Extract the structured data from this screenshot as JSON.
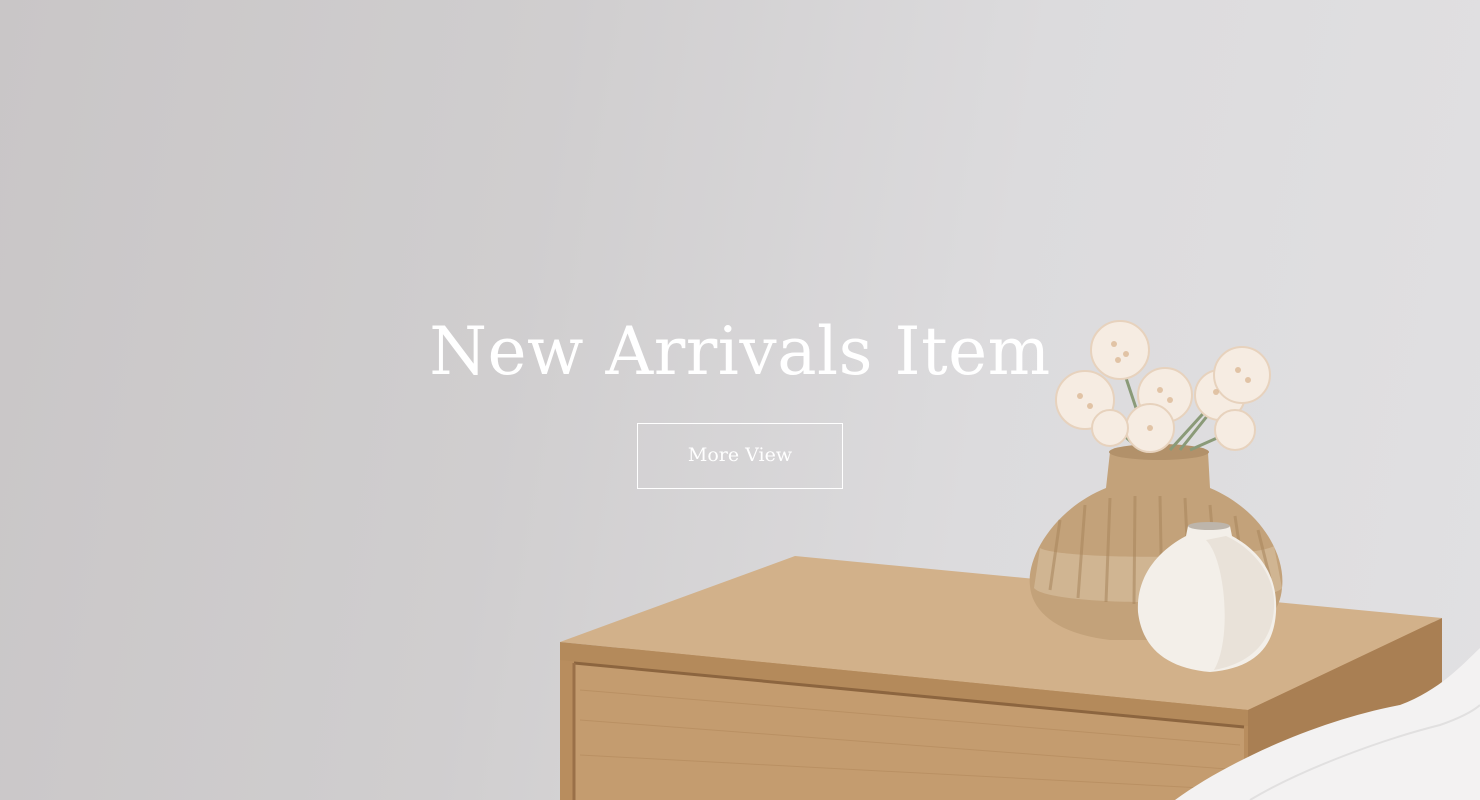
{
  "hero": {
    "title": "New Arrivals Item",
    "button_label": "More View"
  },
  "scene": {
    "image_name": "nightstand-with-vases-photo"
  },
  "colors": {
    "wall": "#d3d1d2",
    "text": "#ffffff",
    "wood": "#caa57b",
    "vase_tan": "#c8a982",
    "vase_white": "#f2eee8"
  }
}
